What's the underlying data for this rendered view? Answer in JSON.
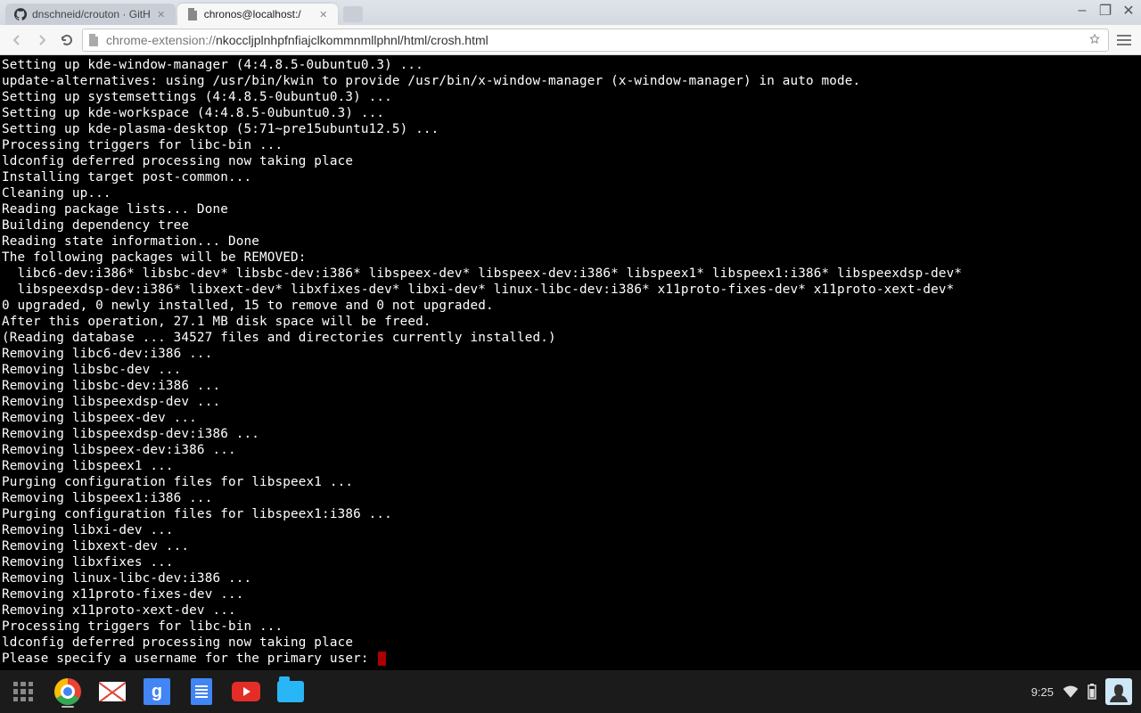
{
  "window_controls": {
    "minimize": "–",
    "maximize": "❐",
    "close": "✕"
  },
  "tabs": [
    {
      "title": "dnschneid/crouton · GitH",
      "active": false,
      "favicon": "github"
    },
    {
      "title": "chronos@localhost:/",
      "active": true,
      "favicon": "page"
    }
  ],
  "toolbar": {
    "url_scheme": "chrome-extension://",
    "url_rest": "nkoccljplnhpfnfiajclkommnmllphnl/html/crosh.html"
  },
  "terminal_lines": [
    "Setting up kde-window-manager (4:4.8.5-0ubuntu0.3) ...",
    "update-alternatives: using /usr/bin/kwin to provide /usr/bin/x-window-manager (x-window-manager) in auto mode.",
    "Setting up systemsettings (4:4.8.5-0ubuntu0.3) ...",
    "Setting up kde-workspace (4:4.8.5-0ubuntu0.3) ...",
    "Setting up kde-plasma-desktop (5:71~pre15ubuntu12.5) ...",
    "Processing triggers for libc-bin ...",
    "ldconfig deferred processing now taking place",
    "Installing target post-common...",
    "Cleaning up...",
    "Reading package lists... Done",
    "Building dependency tree",
    "Reading state information... Done",
    "The following packages will be REMOVED:",
    "  libc6-dev:i386* libsbc-dev* libsbc-dev:i386* libspeex-dev* libspeex-dev:i386* libspeex1* libspeex1:i386* libspeexdsp-dev*",
    "  libspeexdsp-dev:i386* libxext-dev* libxfixes-dev* libxi-dev* linux-libc-dev:i386* x11proto-fixes-dev* x11proto-xext-dev*",
    "0 upgraded, 0 newly installed, 15 to remove and 0 not upgraded.",
    "After this operation, 27.1 MB disk space will be freed.",
    "(Reading database ... 34527 files and directories currently installed.)",
    "Removing libc6-dev:i386 ...",
    "Removing libsbc-dev ...",
    "Removing libsbc-dev:i386 ...",
    "Removing libspeexdsp-dev ...",
    "Removing libspeex-dev ...",
    "Removing libspeexdsp-dev:i386 ...",
    "Removing libspeex-dev:i386 ...",
    "Removing libspeex1 ...",
    "Purging configuration files for libspeex1 ...",
    "Removing libspeex1:i386 ...",
    "Purging configuration files for libspeex1:i386 ...",
    "Removing libxi-dev ...",
    "Removing libxext-dev ...",
    "Removing libxfixes ...",
    "Removing linux-libc-dev:i386 ...",
    "Removing x11proto-fixes-dev ...",
    "Removing x11proto-xext-dev ...",
    "Processing triggers for libc-bin ...",
    "ldconfig deferred processing now taking place"
  ],
  "terminal_prompt": "Please specify a username for the primary user: ",
  "shelf": {
    "apps": [
      "launcher",
      "chrome",
      "gmail",
      "google-search",
      "docs",
      "youtube",
      "files"
    ],
    "clock": "9:25"
  }
}
